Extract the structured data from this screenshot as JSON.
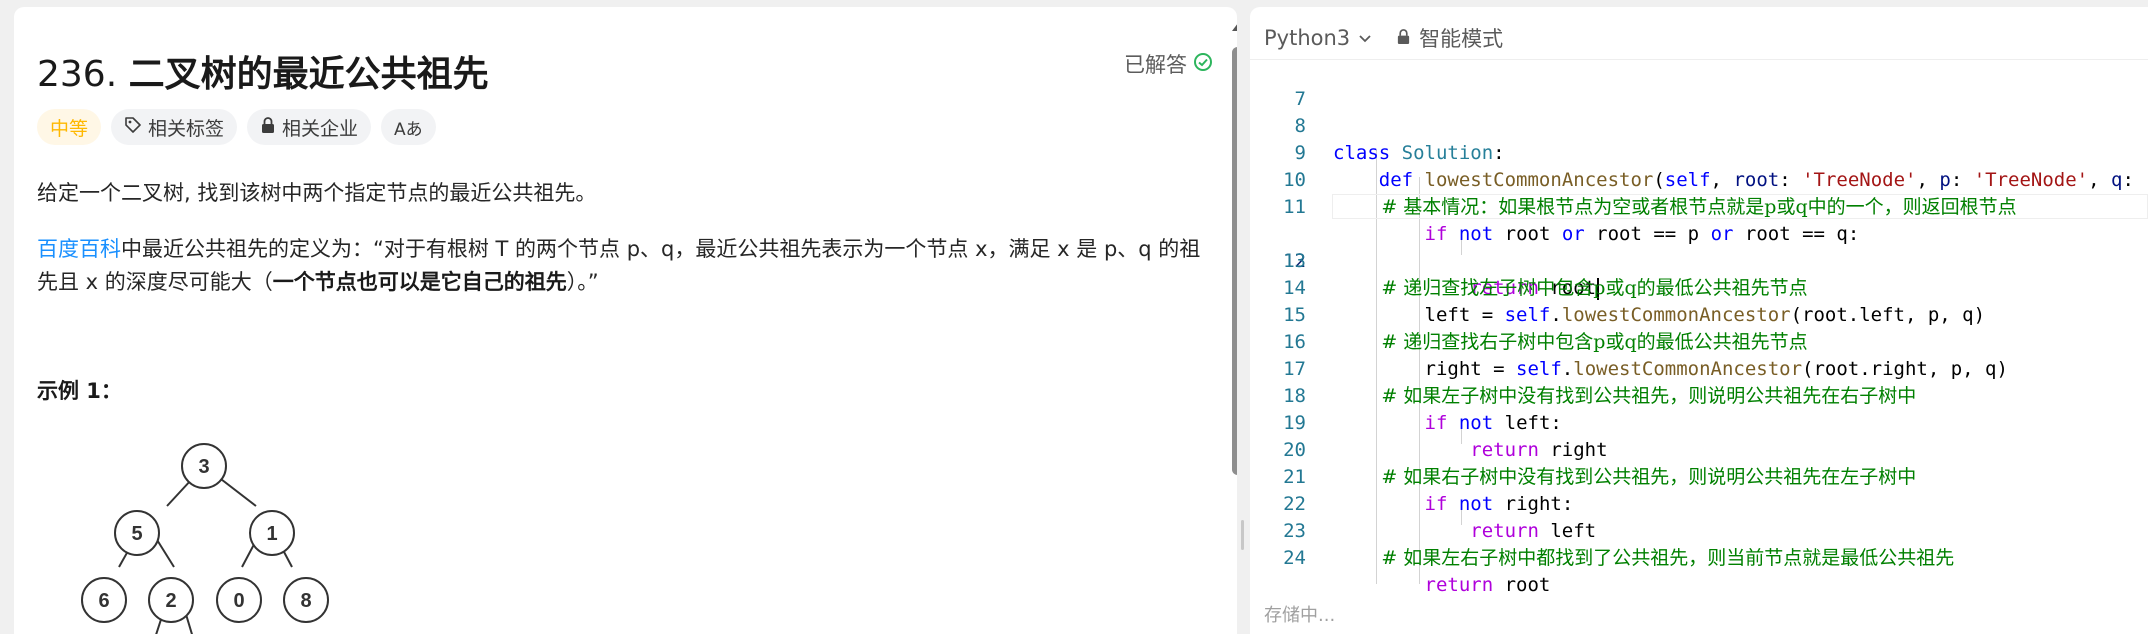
{
  "problem": {
    "number": "236.",
    "title": "二叉树的最近公共祖先",
    "status": "已解答",
    "status_color": "#2db55d",
    "tags": [
      {
        "label": "中等",
        "icon": ""
      },
      {
        "label": "相关标签",
        "icon": "tag-icon"
      },
      {
        "label": "相关企业",
        "icon": "lock-icon"
      },
      {
        "label": "",
        "icon": "translate-icon"
      }
    ],
    "difficulty_color": "#ffb800",
    "translate_glyph": "Aあ",
    "desc1": "给定一个二叉树, 找到该树中两个指定节点的最近公共祖先。",
    "desc2_link": "百度百科",
    "desc2_text": "中最近公共祖先的定义为：“对于有根树 T 的两个节点 p、q，最近公共祖先表示为一个节点 x，满足 x 是 p、q 的祖先且 x 的深度尽可能大（",
    "desc2_bold": "一个节点也可以是它自己的祖先",
    "desc2_end": "）。”",
    "example_title": "示例 1：",
    "tree_nodes": [
      "3",
      "5",
      "1",
      "6",
      "2",
      "0",
      "8"
    ]
  },
  "editor": {
    "language": "Python3",
    "mode": "智能模式",
    "status_text": "存储中...",
    "active_line": "12",
    "lines": [
      {
        "n": "7",
        "code": ""
      },
      {
        "n": "8",
        "code": "class Solution:"
      },
      {
        "n": "9",
        "code": "    def lowestCommonAncestor(self, root: 'TreeNode', p: 'TreeNode', q: 'TreeNode') -> 'TreeNode':"
      },
      {
        "n": "10",
        "code": "        # 基本情况：如果根节点为空或者根节点就是p或q中的一个，则返回根节点"
      },
      {
        "n": "11",
        "code": "        if not root or root == p or root == q:"
      },
      {
        "n": "12",
        "code": "            return root"
      },
      {
        "n": "13",
        "code": "        # 递归查找左子树中包含p或q的最低公共祖先节点"
      },
      {
        "n": "14",
        "code": "        left = self.lowestCommonAncestor(root.left, p, q)"
      },
      {
        "n": "15",
        "code": "        # 递归查找右子树中包含p或q的最低公共祖先节点"
      },
      {
        "n": "16",
        "code": "        right = self.lowestCommonAncestor(root.right, p, q)"
      },
      {
        "n": "17",
        "code": "        # 如果左子树中没有找到公共祖先，则说明公共祖先在右子树中"
      },
      {
        "n": "18",
        "code": "        if not left:"
      },
      {
        "n": "19",
        "code": "            return right"
      },
      {
        "n": "20",
        "code": "        # 如果右子树中没有找到公共祖先，则说明公共祖先在左子树中"
      },
      {
        "n": "21",
        "code": "        if not right:"
      },
      {
        "n": "22",
        "code": "            return left"
      },
      {
        "n": "23",
        "code": "        # 如果左右子树中都找到了公共祖先，则当前节点就是最低公共祖先"
      },
      {
        "n": "24",
        "code": "        return root"
      }
    ]
  }
}
